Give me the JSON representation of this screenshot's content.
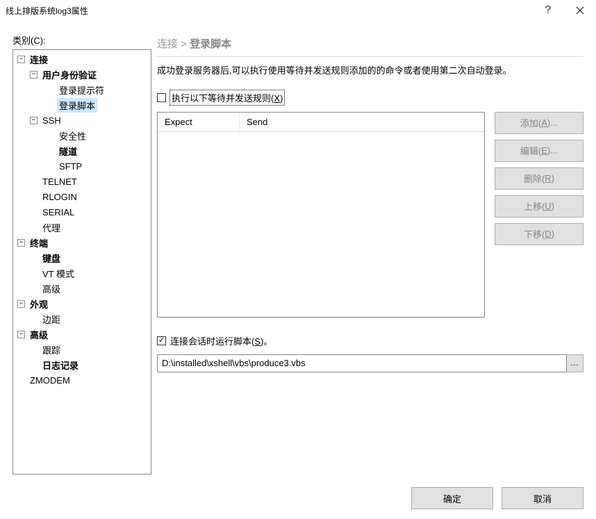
{
  "window": {
    "title": "线上排版系统log3属性"
  },
  "categoryLabel": "类别(C):",
  "tree": {
    "n0": "连接",
    "n1": "用户身份验证",
    "n2": "登录提示符",
    "n3": "登录脚本",
    "n4": "SSH",
    "n5": "安全性",
    "n6": "隧道",
    "n7": "SFTP",
    "n8": "TELNET",
    "n9": "RLOGIN",
    "n10": "SERIAL",
    "n11": "代理",
    "n12": "终端",
    "n13": "键盘",
    "n14": "VT 模式",
    "n15": "高级",
    "n16": "外观",
    "n17": "边距",
    "n18": "高级",
    "n19": "跟踪",
    "n20": "日志记录",
    "n21": "ZMODEM"
  },
  "breadcrumb": {
    "parent": "连接",
    "sep": " > ",
    "current": "登录脚本"
  },
  "description": "成功登录服务器后,可以执行使用等待并发送规则添加的的命令或者使用第二次自动登录。",
  "executeRules": {
    "label_pre": "执行以下等待并发送规则(",
    "key": "X",
    "label_post": ")"
  },
  "table": {
    "col_expect": "Expect",
    "col_send": "Send"
  },
  "buttons": {
    "add_pre": "添加(",
    "add_key": "A",
    "add_post": ")...",
    "edit_pre": "编辑(",
    "edit_key": "E",
    "edit_post": ")...",
    "delete_pre": "删除(",
    "delete_key": "R",
    "delete_post": ")",
    "up_pre": "上移(",
    "up_key": "U",
    "up_post": ")",
    "down_pre": "下移(",
    "down_key": "D",
    "down_post": ")"
  },
  "runScript": {
    "label_pre": "连接会话时运行脚本(",
    "key": "S",
    "post": ")。",
    "checked": true
  },
  "scriptPath": "D:\\installed\\xshell\\vbs\\produce3.vbs",
  "browseLabel": "...",
  "footer": {
    "ok": "确定",
    "cancel": "取消"
  },
  "toggles": {
    "minus": "−",
    "check": "✓"
  }
}
